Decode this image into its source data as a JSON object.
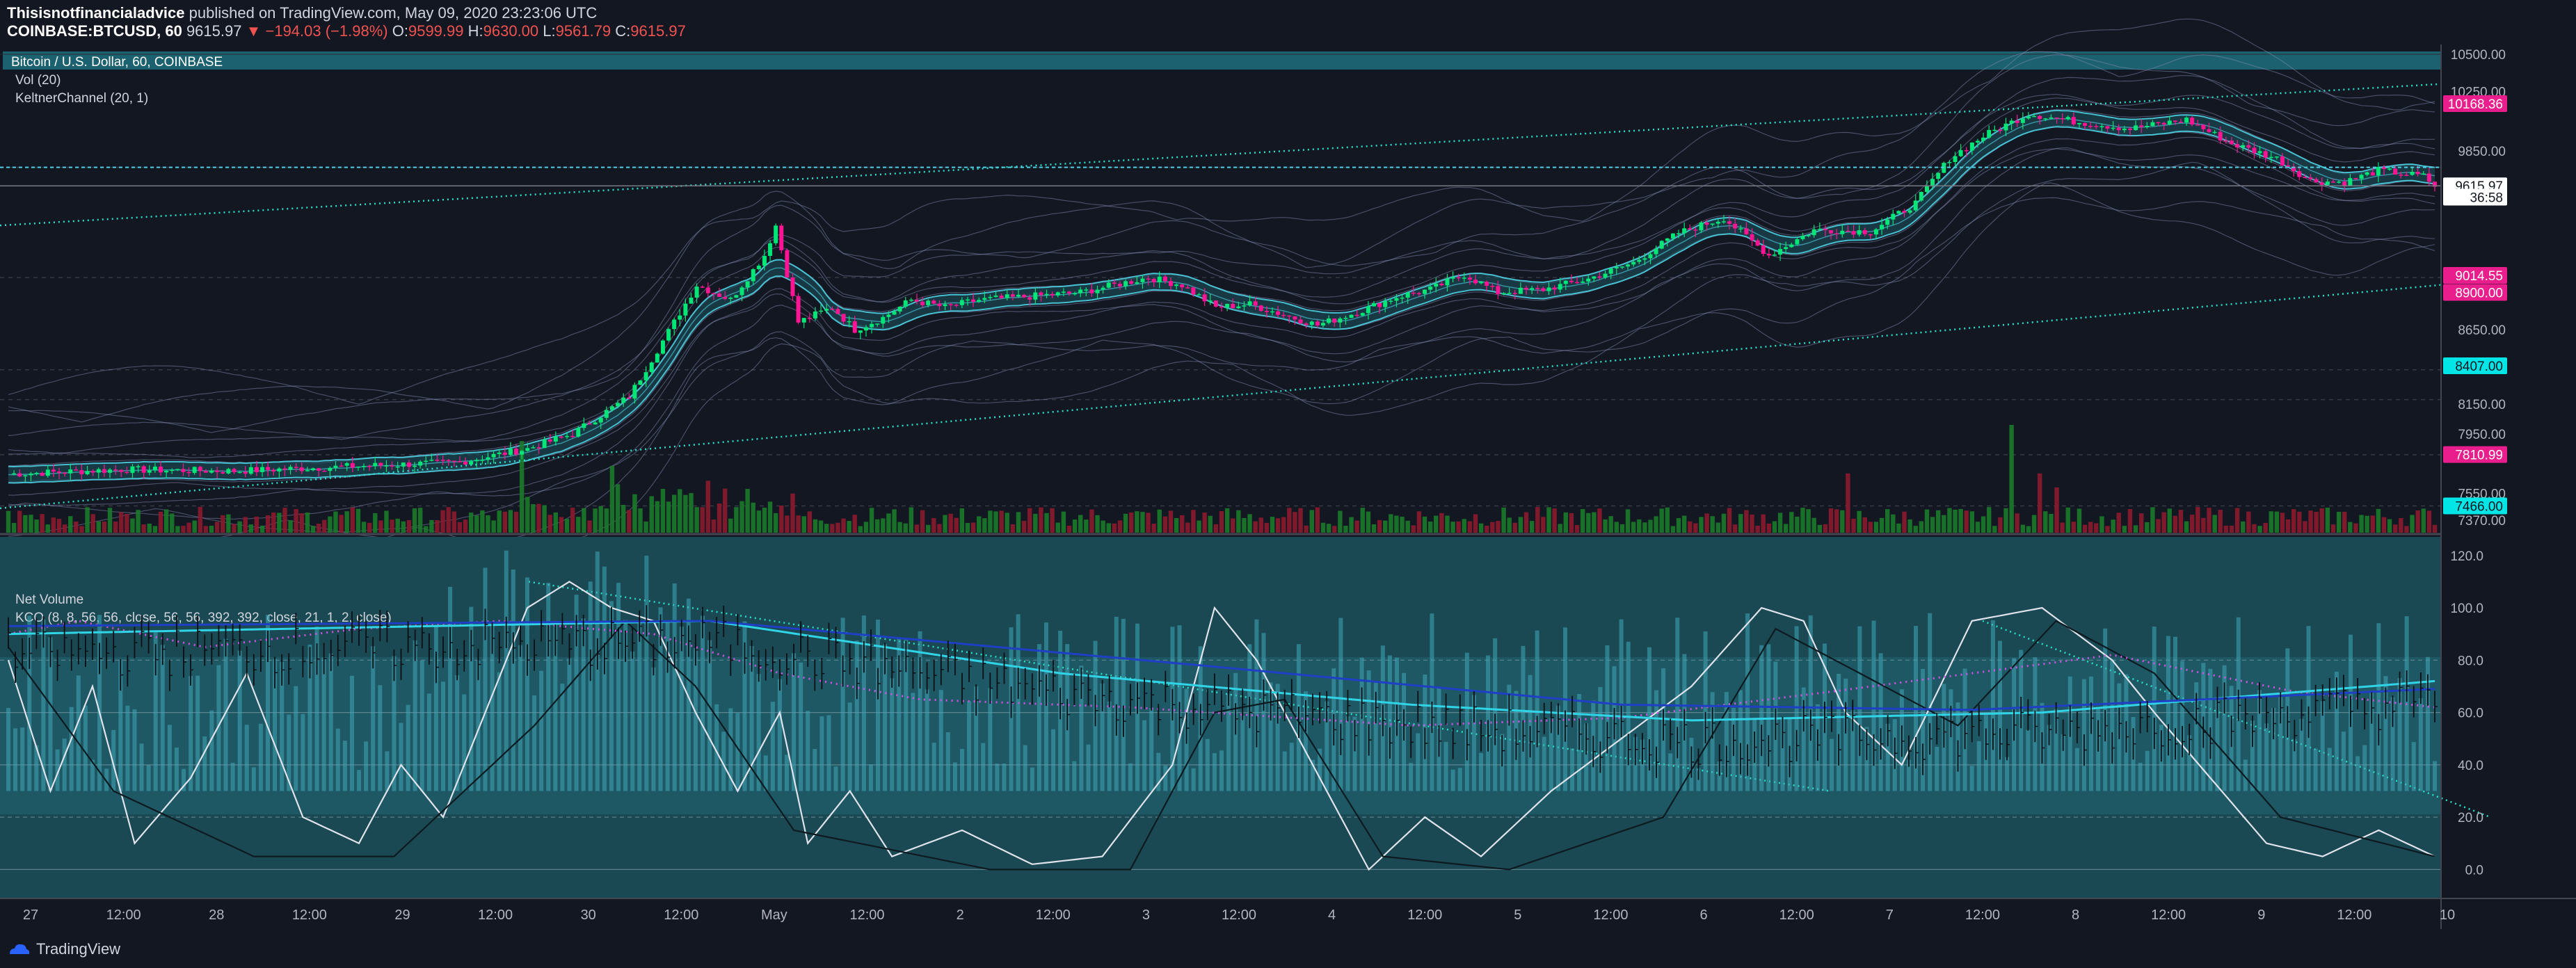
{
  "header": {
    "author": "Thisisnotfinancialadvice",
    "published": "published on TradingView.com, May 09, 2020 23:23:06 UTC",
    "symbol": "COINBASE:BTCUSD, 60",
    "last": "9615.97",
    "change": "▼ −194.03 (−1.98%)",
    "o_label": "O:",
    "o": "9599.99",
    "h_label": "H:",
    "h": "9630.00",
    "l_label": "L:",
    "l": "9561.79",
    "c_label": "C:",
    "c": "9615.97"
  },
  "panes": {
    "main_title": "Bitcoin / U.S. Dollar, 60, COINBASE",
    "vol": "Vol (20)",
    "keltner": "KeltnerChannel (20, 1)",
    "net_volume": "Net Volume",
    "kco": "KCO (8, 8, 56, 56, close, 56, 56, 392, 392, close, 21, 1, 2, close)"
  },
  "footer": {
    "brand": "TradingView"
  },
  "colors": {
    "background": "#131722",
    "up": "#00e676",
    "down": "#ff1493",
    "band": "#4dd0e1",
    "trend": "#26e0c8",
    "magenta_tag": "#e91e8c",
    "cyan_tag": "#00e5e5",
    "indicator_bg": "#1e5360"
  },
  "chart_data": [
    {
      "type": "candlestick",
      "title": "Bitcoin / U.S. Dollar, 60, COINBASE",
      "ylim": [
        7370,
        10500
      ],
      "y_ticks": [
        "10500.00",
        "10250.00",
        "9850.00",
        "8650.00",
        "8150.00",
        "7950.00",
        "7550.00",
        "7370.00"
      ],
      "price_tags": [
        {
          "text": "10168.36",
          "value": 10168.36,
          "style": "magenta"
        },
        {
          "text": "9615.97",
          "value": 9615.97,
          "style": "white"
        },
        {
          "text": "36:58",
          "value": 9540,
          "style": "white"
        },
        {
          "text": "9014.55",
          "value": 9014.55,
          "style": "magenta"
        },
        {
          "text": "8900.00",
          "value": 8900,
          "style": "magenta"
        },
        {
          "text": "8407.00",
          "value": 8407,
          "style": "cyan"
        },
        {
          "text": "7810.99",
          "value": 7810.99,
          "style": "magenta"
        },
        {
          "text": "7466.00",
          "value": 7466,
          "style": "cyan"
        }
      ],
      "price_path": [
        [
          0,
          7680
        ],
        [
          20,
          7710
        ],
        [
          40,
          7700
        ],
        [
          60,
          7730
        ],
        [
          80,
          7760
        ],
        [
          92,
          7850
        ],
        [
          100,
          7950
        ],
        [
          110,
          8200
        ],
        [
          118,
          8700
        ],
        [
          122,
          8950
        ],
        [
          128,
          8850
        ],
        [
          134,
          9150
        ],
        [
          136,
          9350
        ],
        [
          140,
          8700
        ],
        [
          146,
          8800
        ],
        [
          150,
          8650
        ],
        [
          155,
          8730
        ],
        [
          160,
          8850
        ],
        [
          166,
          8800
        ],
        [
          172,
          8850
        ],
        [
          180,
          8870
        ],
        [
          190,
          8900
        ],
        [
          196,
          8950
        ],
        [
          202,
          9000
        ],
        [
          208,
          8950
        ],
        [
          214,
          8800
        ],
        [
          220,
          8820
        ],
        [
          226,
          8750
        ],
        [
          232,
          8680
        ],
        [
          240,
          8780
        ],
        [
          246,
          8870
        ],
        [
          252,
          8920
        ],
        [
          258,
          9020
        ],
        [
          264,
          8900
        ],
        [
          272,
          8920
        ],
        [
          280,
          8990
        ],
        [
          288,
          9100
        ],
        [
          296,
          9300
        ],
        [
          304,
          9400
        ],
        [
          312,
          9150
        ],
        [
          320,
          9320
        ],
        [
          330,
          9310
        ],
        [
          338,
          9500
        ],
        [
          344,
          9800
        ],
        [
          350,
          9950
        ],
        [
          358,
          10100
        ],
        [
          366,
          10050
        ],
        [
          376,
          10000
        ],
        [
          386,
          10060
        ],
        [
          394,
          9900
        ],
        [
          402,
          9800
        ],
        [
          408,
          9650
        ],
        [
          414,
          9640
        ],
        [
          420,
          9720
        ],
        [
          428,
          9680
        ],
        [
          430,
          9615.97
        ]
      ],
      "upper_trendline": {
        "start": 9350,
        "end": 10300
      },
      "lower_trendline": {
        "start": 7450,
        "end": 8950
      },
      "horizontal_lines": [
        9740,
        9615.97
      ],
      "volume_spikes": [
        {
          "i": 91,
          "value": 85
        },
        {
          "i": 107,
          "value": 62
        },
        {
          "i": 326,
          "value": 55
        },
        {
          "i": 355,
          "value": 100
        },
        {
          "i": 360,
          "value": 55
        },
        {
          "i": 363,
          "value": 42
        }
      ],
      "x_ticks": [
        "27",
        "12:00",
        "28",
        "12:00",
        "29",
        "12:00",
        "30",
        "12:00",
        "May",
        "12:00",
        "2",
        "12:00",
        "3",
        "12:00",
        "4",
        "12:00",
        "5",
        "12:00",
        "6",
        "12:00",
        "7",
        "12:00",
        "8",
        "12:00",
        "9",
        "12:00",
        "10"
      ]
    },
    {
      "type": "line",
      "title": "KCO (8, 8, 56, 56, close, 56, 56, 392, 392, close, 21, 1, 2, close)",
      "ylim": [
        -10,
        125
      ],
      "y_ticks": [
        "120.0",
        "100.0",
        "80.0",
        "60.0",
        "40.0",
        "20.0",
        "0.0"
      ],
      "series": [
        {
          "style": "white-osc",
          "values": [
            [
              0,
              80
            ],
            [
              6,
              30
            ],
            [
              12,
              70
            ],
            [
              18,
              10
            ],
            [
              26,
              35
            ],
            [
              34,
              75
            ],
            [
              42,
              20
            ],
            [
              50,
              10
            ],
            [
              56,
              40
            ],
            [
              62,
              20
            ],
            [
              68,
              60
            ],
            [
              74,
              100
            ],
            [
              80,
              110
            ],
            [
              86,
              100
            ],
            [
              92,
              95
            ],
            [
              98,
              60
            ],
            [
              104,
              30
            ],
            [
              110,
              60
            ],
            [
              114,
              10
            ],
            [
              120,
              30
            ],
            [
              126,
              5
            ],
            [
              136,
              15
            ],
            [
              146,
              2
            ],
            [
              156,
              5
            ],
            [
              166,
              40
            ],
            [
              172,
              100
            ],
            [
              178,
              80
            ],
            [
              186,
              40
            ],
            [
              194,
              0
            ],
            [
              202,
              20
            ],
            [
              210,
              5
            ],
            [
              220,
              30
            ],
            [
              230,
              50
            ],
            [
              240,
              70
            ],
            [
              250,
              100
            ],
            [
              256,
              95
            ],
            [
              262,
              60
            ],
            [
              270,
              40
            ],
            [
              280,
              95
            ],
            [
              290,
              100
            ],
            [
              300,
              80
            ],
            [
              306,
              60
            ],
            [
              314,
              35
            ],
            [
              322,
              10
            ],
            [
              330,
              5
            ],
            [
              338,
              15
            ],
            [
              346,
              5
            ]
          ]
        },
        {
          "style": "dark-osc",
          "values": [
            [
              0,
              85
            ],
            [
              15,
              30
            ],
            [
              35,
              5
            ],
            [
              55,
              5
            ],
            [
              75,
              55
            ],
            [
              88,
              95
            ],
            [
              98,
              70
            ],
            [
              112,
              15
            ],
            [
              140,
              0
            ],
            [
              160,
              0
            ],
            [
              172,
              60
            ],
            [
              182,
              65
            ],
            [
              196,
              5
            ],
            [
              214,
              0
            ],
            [
              236,
              20
            ],
            [
              252,
              92
            ],
            [
              264,
              75
            ],
            [
              278,
              55
            ],
            [
              292,
              95
            ],
            [
              306,
              75
            ],
            [
              324,
              20
            ],
            [
              346,
              5
            ]
          ]
        },
        {
          "style": "magenta-dot",
          "values": [
            [
              0,
              90
            ],
            [
              10,
              95
            ],
            [
              28,
              85
            ],
            [
              50,
              92
            ],
            [
              70,
              95
            ],
            [
              92,
              90
            ],
            [
              110,
              75
            ],
            [
              130,
              65
            ],
            [
              160,
              62
            ],
            [
              200,
              55
            ],
            [
              230,
              58
            ],
            [
              260,
              68
            ],
            [
              300,
              82
            ],
            [
              326,
              68
            ],
            [
              346,
              62
            ]
          ]
        },
        {
          "style": "cyan",
          "values": [
            [
              0,
              90
            ],
            [
              100,
              95
            ],
            [
              150,
              75
            ],
            [
              200,
              63
            ],
            [
              240,
              57
            ],
            [
              290,
              60
            ],
            [
              346,
              72
            ]
          ]
        },
        {
          "style": "blue",
          "values": [
            [
              0,
              93
            ],
            [
              100,
              95
            ],
            [
              170,
              78
            ],
            [
              230,
              63
            ],
            [
              280,
              61
            ],
            [
              346,
              69
            ]
          ]
        }
      ],
      "hlines": [
        80,
        60,
        40,
        20,
        0
      ],
      "net_volume_bars": "cyan histogram behind oscillators",
      "time_steps": 346
    }
  ]
}
